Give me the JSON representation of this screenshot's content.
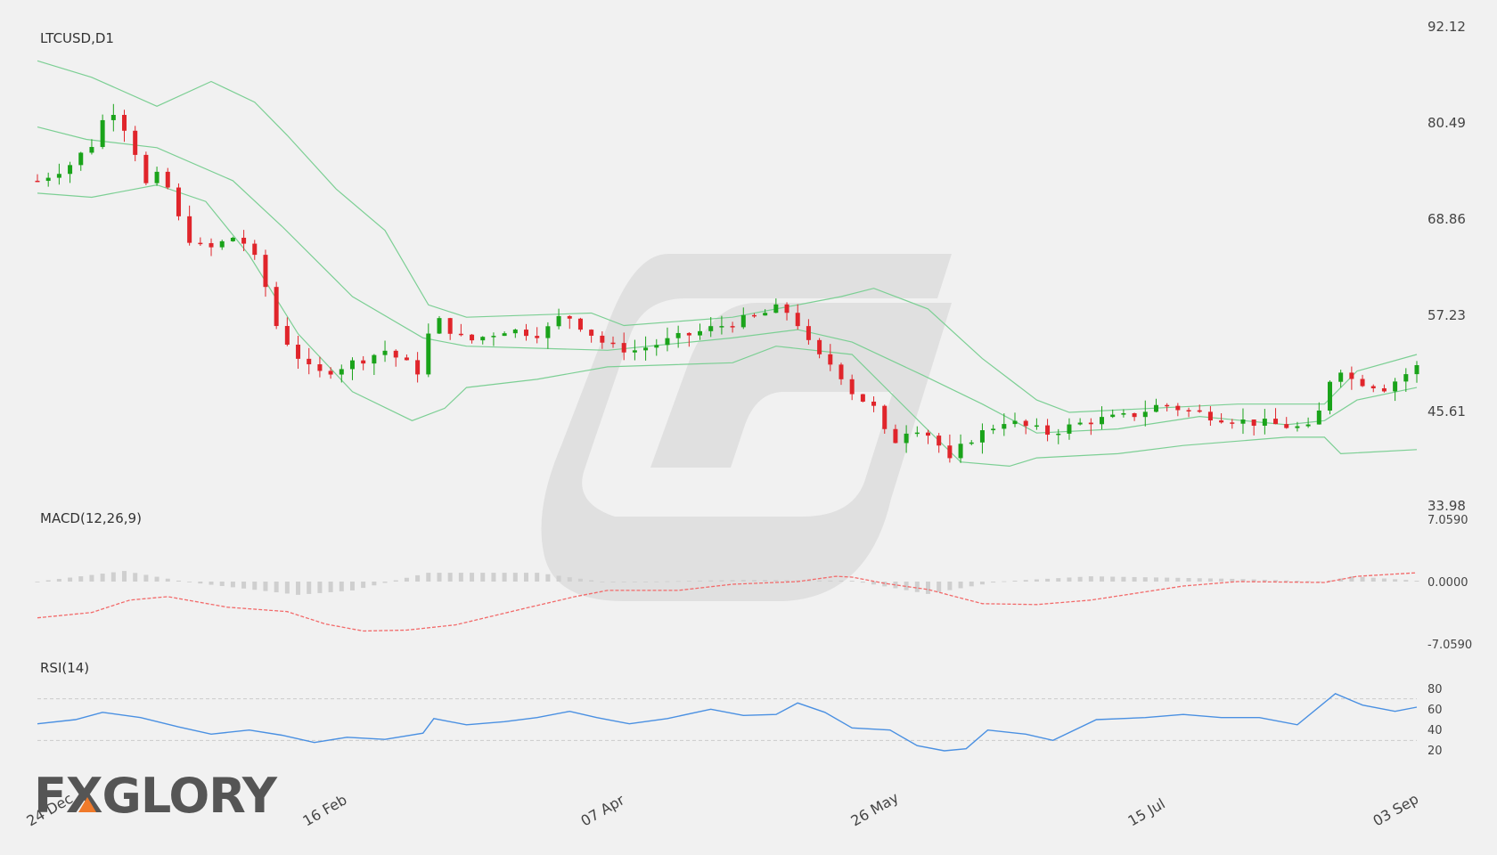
{
  "colors": {
    "up": "#1aa31a",
    "down": "#e0252b",
    "band": "#7ccf94",
    "macd_signal": "#f26a6a",
    "macd_hist": "#cfcfcf",
    "rsi_line": "#4a90e2",
    "grid": "#cccccc",
    "watermark": "#dcdcdc",
    "logo_text": "#555555",
    "logo_accent": "#f07a2a"
  },
  "logo": {
    "text": "FXGLORY"
  },
  "chart_data": [
    {
      "type": "candlestick",
      "title": "LTCUSD,D1",
      "y_ticks": [
        "92.12",
        "80.49",
        "68.86",
        "57.23",
        "45.61",
        "33.98"
      ],
      "ylim": [
        33.98,
        92.12
      ],
      "x_ticks": [
        {
          "label": "24 Dec",
          "date": "2023-12-24"
        },
        {
          "label": "16 Feb",
          "date": "2024-02-16"
        },
        {
          "label": "07 Apr",
          "date": "2024-04-07"
        },
        {
          "label": "26 May",
          "date": "2024-05-26"
        },
        {
          "label": "15 Jul",
          "date": "2024-07-15"
        },
        {
          "label": "03 Sep",
          "date": "2024-09-03"
        }
      ],
      "date_range": [
        "2023-12-24",
        "2024-09-03"
      ],
      "close_keypoints": [
        [
          "2023-12-24",
          73.5
        ],
        [
          "2023-12-30",
          75.5
        ],
        [
          "2024-01-04",
          78.5
        ],
        [
          "2024-01-06",
          83.0
        ],
        [
          "2024-01-10",
          79.0
        ],
        [
          "2024-01-13",
          73.0
        ],
        [
          "2024-01-16",
          74.5
        ],
        [
          "2024-01-20",
          67.0
        ],
        [
          "2024-01-24",
          65.0
        ],
        [
          "2024-01-30",
          67.0
        ],
        [
          "2024-02-03",
          63.0
        ],
        [
          "2024-02-06",
          56.0
        ],
        [
          "2024-02-09",
          53.0
        ],
        [
          "2024-02-13",
          50.0
        ],
        [
          "2024-02-20",
          51.5
        ],
        [
          "2024-02-26",
          53.0
        ],
        [
          "2024-03-03",
          50.5
        ],
        [
          "2024-03-06",
          57.0
        ],
        [
          "2024-03-12",
          54.0
        ],
        [
          "2024-03-19",
          55.5
        ],
        [
          "2024-03-26",
          55.0
        ],
        [
          "2024-03-30",
          57.5
        ],
        [
          "2024-04-07",
          53.5
        ],
        [
          "2024-04-12",
          53.0
        ],
        [
          "2024-04-20",
          54.5
        ],
        [
          "2024-04-28",
          56.0
        ],
        [
          "2024-05-04",
          57.0
        ],
        [
          "2024-05-08",
          58.0
        ],
        [
          "2024-05-11",
          57.5
        ],
        [
          "2024-05-15",
          52.5
        ],
        [
          "2024-05-19",
          51.0
        ],
        [
          "2024-05-22",
          48.0
        ],
        [
          "2024-05-26",
          46.0
        ],
        [
          "2024-05-29",
          41.5
        ],
        [
          "2024-06-02",
          44.0
        ],
        [
          "2024-06-06",
          42.5
        ],
        [
          "2024-06-09",
          39.5
        ],
        [
          "2024-06-12",
          42.0
        ],
        [
          "2024-06-19",
          44.5
        ],
        [
          "2024-06-27",
          43.0
        ],
        [
          "2024-07-05",
          44.5
        ],
        [
          "2024-07-12",
          45.0
        ],
        [
          "2024-07-18",
          46.5
        ],
        [
          "2024-07-24",
          45.5
        ],
        [
          "2024-08-01",
          44.5
        ],
        [
          "2024-08-08",
          44.0
        ],
        [
          "2024-08-14",
          43.5
        ],
        [
          "2024-08-16",
          45.5
        ],
        [
          "2024-08-19",
          51.5
        ],
        [
          "2024-08-22",
          49.5
        ],
        [
          "2024-08-28",
          48.5
        ],
        [
          "2024-09-03",
          51.0
        ]
      ],
      "bollinger": {
        "upper": [
          [
            "2023-12-24",
            88.0
          ],
          [
            "2024-01-03",
            86.0
          ],
          [
            "2024-01-15",
            82.5
          ],
          [
            "2024-01-25",
            85.5
          ],
          [
            "2024-02-02",
            83.0
          ],
          [
            "2024-02-08",
            79.0
          ],
          [
            "2024-02-17",
            72.5
          ],
          [
            "2024-02-26",
            67.5
          ],
          [
            "2024-03-05",
            58.5
          ],
          [
            "2024-03-12",
            57.0
          ],
          [
            "2024-04-04",
            57.5
          ],
          [
            "2024-04-10",
            56.0
          ],
          [
            "2024-04-30",
            57.0
          ],
          [
            "2024-05-08",
            58.0
          ],
          [
            "2024-05-20",
            59.5
          ],
          [
            "2024-05-26",
            60.5
          ],
          [
            "2024-06-05",
            58.0
          ],
          [
            "2024-06-15",
            52.0
          ],
          [
            "2024-06-25",
            47.0
          ],
          [
            "2024-07-01",
            45.5
          ],
          [
            "2024-08-01",
            46.5
          ],
          [
            "2024-08-17",
            46.5
          ],
          [
            "2024-08-23",
            50.5
          ],
          [
            "2024-09-03",
            52.5
          ]
        ],
        "middle": [
          [
            "2023-12-24",
            80.0
          ],
          [
            "2024-01-02",
            78.5
          ],
          [
            "2024-01-15",
            77.5
          ],
          [
            "2024-01-29",
            73.5
          ],
          [
            "2024-02-07",
            68.0
          ],
          [
            "2024-02-20",
            59.5
          ],
          [
            "2024-03-04",
            54.5
          ],
          [
            "2024-03-12",
            53.5
          ],
          [
            "2024-04-07",
            53.0
          ],
          [
            "2024-04-30",
            54.5
          ],
          [
            "2024-05-12",
            55.5
          ],
          [
            "2024-05-22",
            54.0
          ],
          [
            "2024-06-04",
            50.0
          ],
          [
            "2024-06-15",
            46.5
          ],
          [
            "2024-06-25",
            43.0
          ],
          [
            "2024-07-10",
            43.5
          ],
          [
            "2024-07-25",
            45.0
          ],
          [
            "2024-08-10",
            44.0
          ],
          [
            "2024-08-17",
            44.5
          ],
          [
            "2024-08-23",
            47.0
          ],
          [
            "2024-09-03",
            48.5
          ]
        ],
        "lower": [
          [
            "2023-12-24",
            72.0
          ],
          [
            "2024-01-03",
            71.5
          ],
          [
            "2024-01-15",
            73.0
          ],
          [
            "2024-01-24",
            71.0
          ],
          [
            "2024-02-01",
            64.5
          ],
          [
            "2024-02-10",
            55.0
          ],
          [
            "2024-02-20",
            48.0
          ],
          [
            "2024-03-02",
            44.5
          ],
          [
            "2024-03-08",
            46.0
          ],
          [
            "2024-03-12",
            48.5
          ],
          [
            "2024-03-25",
            49.5
          ],
          [
            "2024-04-07",
            51.0
          ],
          [
            "2024-04-30",
            51.5
          ],
          [
            "2024-05-08",
            53.5
          ],
          [
            "2024-05-22",
            52.5
          ],
          [
            "2024-06-04",
            44.0
          ],
          [
            "2024-06-11",
            39.5
          ],
          [
            "2024-06-20",
            39.0
          ],
          [
            "2024-06-25",
            40.0
          ],
          [
            "2024-07-10",
            40.5
          ],
          [
            "2024-07-22",
            41.5
          ],
          [
            "2024-08-10",
            42.5
          ],
          [
            "2024-08-17",
            42.5
          ],
          [
            "2024-08-20",
            40.5
          ],
          [
            "2024-09-03",
            41.0
          ]
        ]
      }
    },
    {
      "type": "line",
      "title": "MACD(12,26,9)",
      "y_ticks": [
        "7.0590",
        "0.0000",
        "-7.0590"
      ],
      "ylim": [
        -7.059,
        7.059
      ],
      "signal": [
        [
          "2023-12-24",
          -4.1
        ],
        [
          "2024-01-03",
          -3.5
        ],
        [
          "2024-01-10",
          -2.1
        ],
        [
          "2024-01-17",
          -1.7
        ],
        [
          "2024-01-28",
          -2.9
        ],
        [
          "2024-02-08",
          -3.4
        ],
        [
          "2024-02-15",
          -4.8
        ],
        [
          "2024-02-22",
          -5.6
        ],
        [
          "2024-03-01",
          -5.5
        ],
        [
          "2024-03-10",
          -4.9
        ],
        [
          "2024-03-23",
          -3.0
        ],
        [
          "2024-04-01",
          -1.7
        ],
        [
          "2024-04-07",
          -1.0
        ],
        [
          "2024-04-20",
          -1.0
        ],
        [
          "2024-04-30",
          -0.3
        ],
        [
          "2024-05-12",
          0.0
        ],
        [
          "2024-05-19",
          0.6
        ],
        [
          "2024-05-22",
          0.5
        ],
        [
          "2024-05-28",
          -0.2
        ],
        [
          "2024-06-05",
          -0.9
        ],
        [
          "2024-06-15",
          -2.5
        ],
        [
          "2024-06-25",
          -2.6
        ],
        [
          "2024-07-05",
          -2.1
        ],
        [
          "2024-07-22",
          -0.5
        ],
        [
          "2024-08-01",
          0.0
        ],
        [
          "2024-08-17",
          -0.1
        ],
        [
          "2024-08-23",
          0.6
        ],
        [
          "2024-09-03",
          1.0
        ]
      ],
      "histogram": [
        [
          "2023-12-24",
          0.0
        ],
        [
          "2024-01-01",
          0.6
        ],
        [
          "2024-01-09",
          1.2
        ],
        [
          "2024-01-20",
          0.0
        ],
        [
          "2024-02-10",
          -1.5
        ],
        [
          "2024-02-20",
          -1.0
        ],
        [
          "2024-03-05",
          1.0
        ],
        [
          "2024-03-25",
          1.0
        ],
        [
          "2024-04-07",
          -0.1
        ],
        [
          "2024-05-01",
          0.2
        ],
        [
          "2024-05-22",
          0.1
        ],
        [
          "2024-06-05",
          -1.4
        ],
        [
          "2024-06-18",
          0.0
        ],
        [
          "2024-07-05",
          0.6
        ],
        [
          "2024-08-01",
          0.3
        ],
        [
          "2024-08-17",
          0.0
        ],
        [
          "2024-08-22",
          0.6
        ],
        [
          "2024-09-03",
          0.1
        ]
      ]
    },
    {
      "type": "line",
      "title": "RSI(14)",
      "y_ticks": [
        "80",
        "60",
        "40",
        "20"
      ],
      "ylim": [
        10,
        85
      ],
      "levels": [
        70,
        30
      ],
      "values": [
        [
          "2023-12-24",
          46
        ],
        [
          "2023-12-31",
          50
        ],
        [
          "2024-01-05",
          57
        ],
        [
          "2024-01-12",
          52
        ],
        [
          "2024-01-19",
          43
        ],
        [
          "2024-01-25",
          36
        ],
        [
          "2024-02-01",
          40
        ],
        [
          "2024-02-07",
          35
        ],
        [
          "2024-02-13",
          28
        ],
        [
          "2024-02-19",
          33
        ],
        [
          "2024-02-26",
          31
        ],
        [
          "2024-03-04",
          37
        ],
        [
          "2024-03-06",
          51
        ],
        [
          "2024-03-12",
          45
        ],
        [
          "2024-03-19",
          48
        ],
        [
          "2024-03-25",
          52
        ],
        [
          "2024-03-31",
          58
        ],
        [
          "2024-04-05",
          52
        ],
        [
          "2024-04-11",
          46
        ],
        [
          "2024-04-18",
          51
        ],
        [
          "2024-04-26",
          60
        ],
        [
          "2024-05-02",
          54
        ],
        [
          "2024-05-08",
          55
        ],
        [
          "2024-05-12",
          66
        ],
        [
          "2024-05-17",
          57
        ],
        [
          "2024-05-22",
          42
        ],
        [
          "2024-05-29",
          40
        ],
        [
          "2024-06-03",
          25
        ],
        [
          "2024-06-08",
          20
        ],
        [
          "2024-06-12",
          22
        ],
        [
          "2024-06-16",
          40
        ],
        [
          "2024-06-23",
          36
        ],
        [
          "2024-06-28",
          30
        ],
        [
          "2024-07-06",
          50
        ],
        [
          "2024-07-15",
          52
        ],
        [
          "2024-07-22",
          55
        ],
        [
          "2024-07-29",
          52
        ],
        [
          "2024-08-05",
          52
        ],
        [
          "2024-08-12",
          45
        ],
        [
          "2024-08-19",
          75
        ],
        [
          "2024-08-24",
          64
        ],
        [
          "2024-08-30",
          58
        ],
        [
          "2024-09-03",
          62
        ]
      ]
    }
  ]
}
